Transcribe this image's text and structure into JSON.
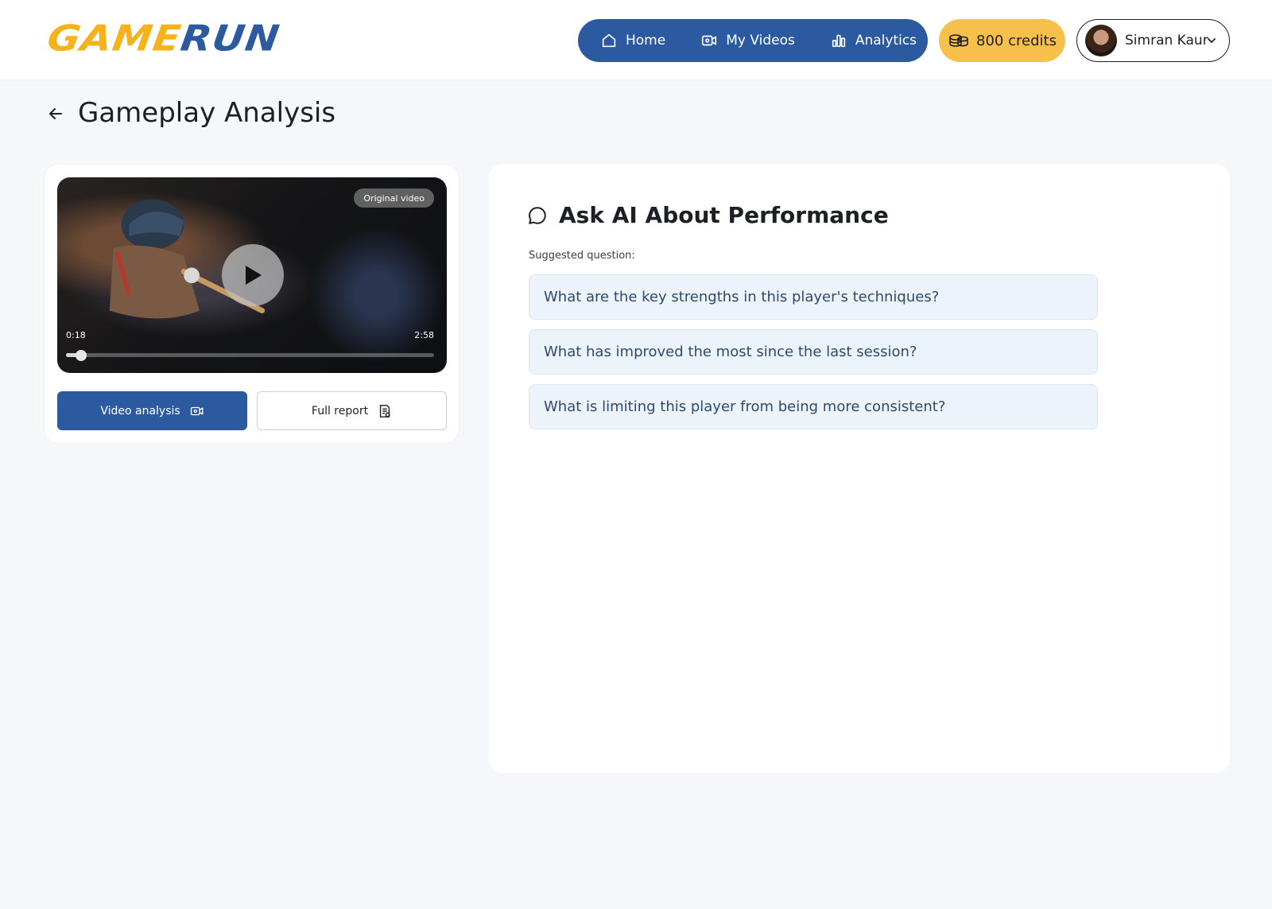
{
  "header": {
    "logo": {
      "part1": "GAME",
      "part2": "RUN"
    },
    "nav": [
      {
        "label": "Home",
        "icon": "home-icon"
      },
      {
        "label": "My Videos",
        "icon": "video-icon"
      },
      {
        "label": "Analytics",
        "icon": "bar-chart-icon"
      }
    ],
    "credits": {
      "label": "800 credits",
      "icon": "coins-icon"
    },
    "user": {
      "name": "Simran Kaur",
      "icon": "chevron-down-icon"
    }
  },
  "page": {
    "title": "Gameplay Analysis",
    "back_icon": "arrow-left-icon"
  },
  "video": {
    "badge": "Original video",
    "current_time": "0:18",
    "duration": "2:58",
    "progress": 0.04
  },
  "actions": {
    "video_analysis_label": "Video analysis",
    "full_report_label": "Full report"
  },
  "ask": {
    "title": "Ask AI About Performance",
    "suggested_label": "Suggested question:",
    "questions": [
      "What are the key strengths in this player's techniques?",
      "What has improved the most since the last session?",
      "What is limiting this player from being more consistent?"
    ]
  },
  "colors": {
    "brand_yellow": "#f6b21b",
    "brand_blue": "#2c5aa0",
    "credits_bg": "#f7c04a",
    "question_bg": "#edf3fb"
  }
}
